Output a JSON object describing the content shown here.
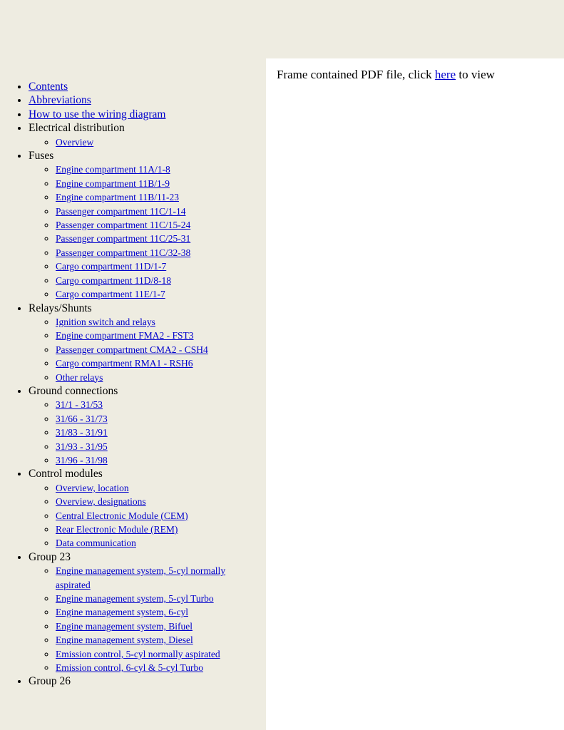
{
  "content": {
    "prefix": "Frame contained PDF file, click ",
    "link_label": "here",
    "suffix": " to view"
  },
  "nav": {
    "items": [
      {
        "label": "Contents",
        "type": "link",
        "children": []
      },
      {
        "label": "Abbreviations",
        "type": "link",
        "children": []
      },
      {
        "label": "How to use the wiring diagram",
        "type": "link",
        "children": []
      },
      {
        "label": "Electrical distribution",
        "type": "text",
        "children": [
          {
            "label": "Overview",
            "type": "link"
          }
        ]
      },
      {
        "label": "Fuses",
        "type": "text",
        "children": [
          {
            "label": "Engine compartment 11A/1-8",
            "type": "link"
          },
          {
            "label": "Engine compartment 11B/1-9",
            "type": "link"
          },
          {
            "label": "Engine compartment 11B/11-23",
            "type": "link"
          },
          {
            "label": "Passenger compartment 11C/1-14",
            "type": "link"
          },
          {
            "label": "Passenger compartment 11C/15-24",
            "type": "link"
          },
          {
            "label": "Passenger compartment 11C/25-31",
            "type": "link"
          },
          {
            "label": "Passenger compartment 11C/32-38",
            "type": "link"
          },
          {
            "label": "Cargo compartment 11D/1-7",
            "type": "link"
          },
          {
            "label": "Cargo compartment 11D/8-18",
            "type": "link"
          },
          {
            "label": "Cargo compartment 11E/1-7",
            "type": "link"
          }
        ]
      },
      {
        "label": "Relays/Shunts",
        "type": "text",
        "children": [
          {
            "label": "Ignition switch and relays",
            "type": "link"
          },
          {
            "label": "Engine compartment FMA2 - FST3",
            "type": "link"
          },
          {
            "label": "Passenger compartment CMA2 - CSH4",
            "type": "link"
          },
          {
            "label": "Cargo compartment RMA1 - RSH6",
            "type": "link"
          },
          {
            "label": "Other relays",
            "type": "link"
          }
        ]
      },
      {
        "label": "Ground connections",
        "type": "text",
        "children": [
          {
            "label": "31/1 - 31/53",
            "type": "link"
          },
          {
            "label": "31/66 - 31/73",
            "type": "link"
          },
          {
            "label": "31/83 - 31/91",
            "type": "link"
          },
          {
            "label": "31/93 - 31/95",
            "type": "link"
          },
          {
            "label": "31/96 - 31/98",
            "type": "link"
          }
        ]
      },
      {
        "label": "Control modules",
        "type": "text",
        "children": [
          {
            "label": "Overview, location",
            "type": "link"
          },
          {
            "label": "Overview, designations",
            "type": "link"
          },
          {
            "label": "Central Electronic Module (CEM)",
            "type": "link"
          },
          {
            "label": "Rear Electronic Module (REM)",
            "type": "link"
          },
          {
            "label": "Data communication",
            "type": "link"
          }
        ]
      },
      {
        "label": "Group 23",
        "type": "text",
        "children": [
          {
            "label": "Engine management system, 5-cyl normally aspirated",
            "type": "link"
          },
          {
            "label": "Engine management system, 5-cyl Turbo",
            "type": "link"
          },
          {
            "label": "Engine management system, 6-cyl",
            "type": "link"
          },
          {
            "label": "Engine management system, Bifuel",
            "type": "link"
          },
          {
            "label": "Engine management system, Diesel",
            "type": "link"
          },
          {
            "label": "Emission control, 5-cyl normally aspirated",
            "type": "link"
          },
          {
            "label": "Emission control, 6-cyl & 5-cyl Turbo",
            "type": "link"
          }
        ]
      },
      {
        "label": "Group 26",
        "type": "text",
        "children": []
      }
    ]
  }
}
